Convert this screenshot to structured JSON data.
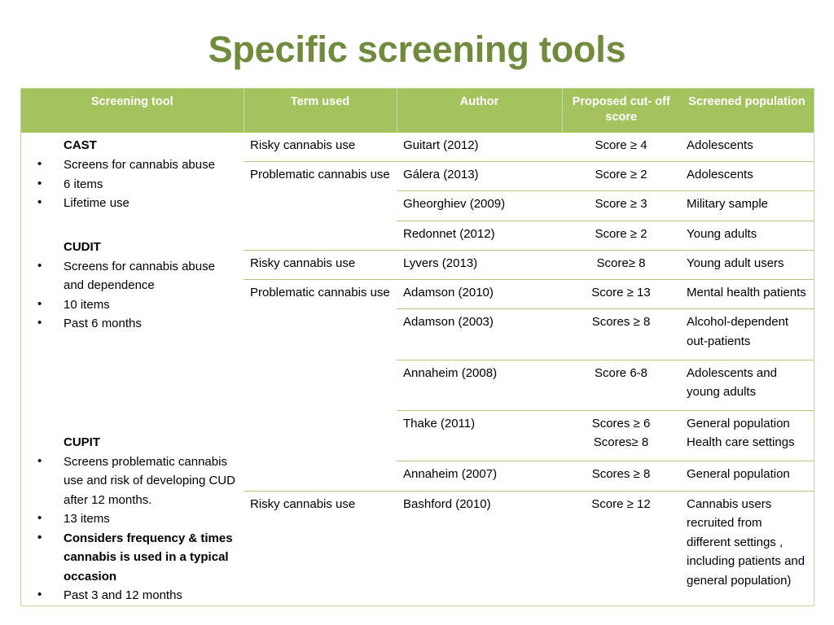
{
  "slide": {
    "title": "Specific screening tools",
    "title_color": "#6f8b3b",
    "header_bg": "#a4c25e",
    "border_color": "#b5c77e"
  },
  "table": {
    "headers": [
      "Screening tool",
      "Term used",
      "Author",
      "Proposed cut- off score",
      "Screened population"
    ],
    "tools": [
      {
        "name": "CAST",
        "bullets": [
          {
            "text": "Screens for cannabis abuse",
            "bold": false
          },
          {
            "text": "6 items",
            "bold": false
          },
          {
            "text": "Lifetime use",
            "bold": false
          }
        ]
      },
      {
        "name": "CUDIT",
        "bullets": [
          {
            "text": "Screens for cannabis abuse and dependence",
            "bold": false
          },
          {
            "text": "10 items",
            "bold": false
          },
          {
            "text": "Past 6 months",
            "bold": false
          }
        ]
      },
      {
        "name": "CUPIT",
        "bullets": [
          {
            "text": "Screens problematic cannabis use and risk of developing CUD after 12 months.",
            "bold": false
          },
          {
            "text": "13 items",
            "bold": false
          },
          {
            "text": "Considers frequency & times cannabis is used in a typical occasion",
            "bold": true
          },
          {
            "text": "Past 3 and 12 months",
            "bold": false
          }
        ]
      }
    ],
    "rows": [
      {
        "term": "Risky cannabis use",
        "author": "Guitart (2012)",
        "score": [
          "Score ≥ 4"
        ],
        "population": [
          "Adolescents"
        ]
      },
      {
        "term": "Problematic cannabis use",
        "author": "Gálera (2013)",
        "score": [
          "Score ≥ 2"
        ],
        "population": [
          "Adolescents"
        ]
      },
      {
        "term": "",
        "author": "Gheorghiev (2009)",
        "score": [
          "Score ≥ 3"
        ],
        "population": [
          "Military sample"
        ]
      },
      {
        "term": "",
        "author": "Redonnet (2012)",
        "score": [
          "Score ≥ 2"
        ],
        "population": [
          "Young adults"
        ]
      },
      {
        "term": "Risky cannabis use",
        "author": "Lyvers (2013)",
        "score": [
          "Score≥ 8"
        ],
        "population": [
          "Young adult users"
        ]
      },
      {
        "term": "Problematic cannabis use",
        "author": "Adamson (2010)",
        "score": [
          "Score ≥ 13"
        ],
        "population": [
          "Mental health patients"
        ]
      },
      {
        "term": "",
        "author": "Adamson (2003)",
        "score": [
          "Scores ≥ 8"
        ],
        "population": [
          "Alcohol-dependent out-patients"
        ]
      },
      {
        "term": "",
        "author": "Annaheim (2008)",
        "score": [
          "Score  6-8"
        ],
        "population": [
          "Adolescents and young adults"
        ]
      },
      {
        "term": "",
        "author": "Thake (2011)",
        "score": [
          "Scores ≥ 6",
          "Scores≥ 8"
        ],
        "population": [
          "General population",
          "Health care settings"
        ]
      },
      {
        "term": "",
        "author": "Annaheim (2007)",
        "score": [
          "Scores ≥ 8"
        ],
        "population": [
          "General population"
        ]
      },
      {
        "term": "Risky cannabis use",
        "author": "Bashford (2010)",
        "score": [
          "Score ≥ 12"
        ],
        "population": [
          "Cannabis users recruited from different settings , including patients and general population)"
        ]
      }
    ]
  }
}
